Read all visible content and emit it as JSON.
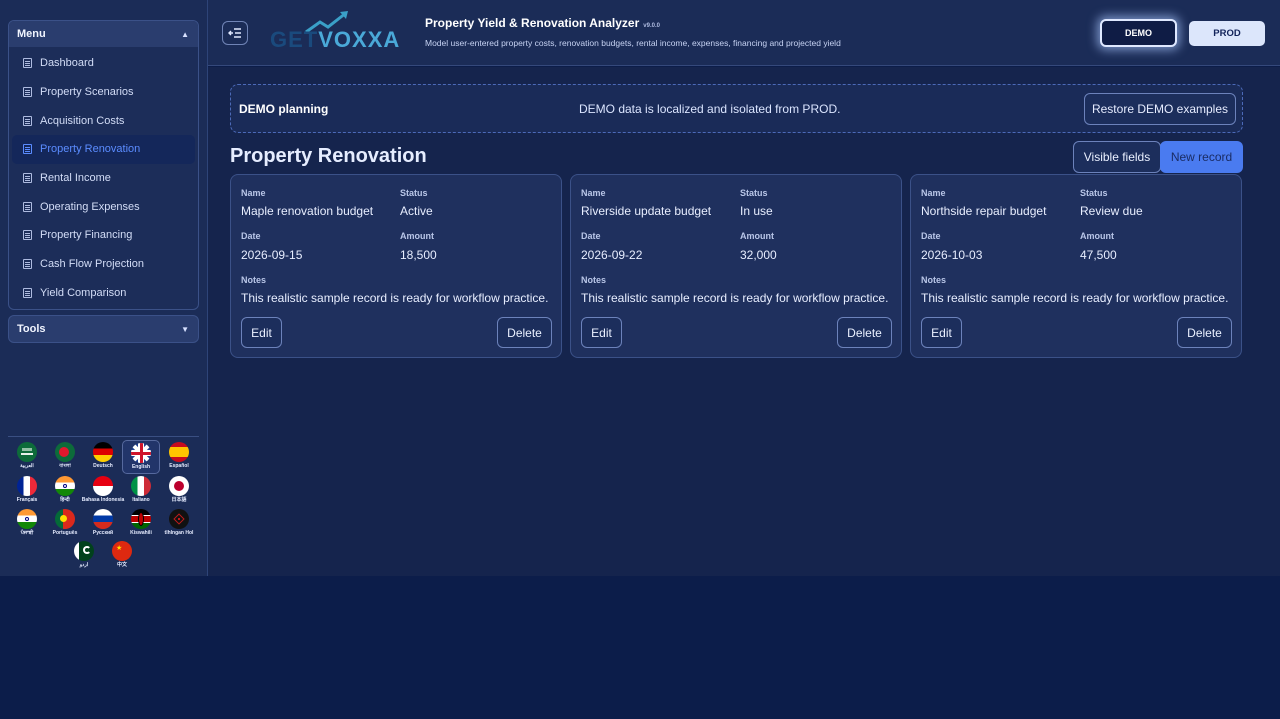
{
  "sidebar": {
    "menu_label": "Menu",
    "tools_label": "Tools",
    "items": [
      {
        "label": "Dashboard"
      },
      {
        "label": "Property Scenarios"
      },
      {
        "label": "Acquisition Costs"
      },
      {
        "label": "Property Renovation"
      },
      {
        "label": "Rental Income"
      },
      {
        "label": "Operating Expenses"
      },
      {
        "label": "Property Financing"
      },
      {
        "label": "Cash Flow Projection"
      },
      {
        "label": "Yield Comparison"
      }
    ],
    "active_item": "Property Renovation",
    "languages": [
      {
        "label": "العربية"
      },
      {
        "label": "বাংলা"
      },
      {
        "label": "Deutsch"
      },
      {
        "label": "English"
      },
      {
        "label": "Español"
      },
      {
        "label": "Français"
      },
      {
        "label": "हिन्दी"
      },
      {
        "label": "Bahasa Indonesia"
      },
      {
        "label": "Italiano"
      },
      {
        "label": "日本語"
      },
      {
        "label": "ਪੰਜਾਬੀ"
      },
      {
        "label": "Português"
      },
      {
        "label": "Русский"
      },
      {
        "label": "Kiswahili"
      },
      {
        "label": "tlhIngan Hol"
      },
      {
        "label": "اردو"
      },
      {
        "label": "中文"
      }
    ],
    "selected_language": "English"
  },
  "header": {
    "logo_text_a": "GET",
    "logo_text_b": "VOXXA",
    "title": "Property Yield & Renovation Analyzer",
    "version": "v9.0.0",
    "subtitle": "Model user-entered property costs, renovation budgets, rental income, expenses, financing and projected yield",
    "demo_label": "DEMO",
    "prod_label": "PROD"
  },
  "banner": {
    "title": "DEMO planning",
    "message": "DEMO data is localized and isolated from PROD.",
    "restore_label": "Restore DEMO examples"
  },
  "main": {
    "page_title": "Property Renovation",
    "visible_fields_label": "Visible fields",
    "new_record_label": "New record"
  },
  "field_labels": {
    "name": "Name",
    "status": "Status",
    "date": "Date",
    "amount": "Amount",
    "notes": "Notes"
  },
  "records": [
    {
      "name": "Maple renovation budget",
      "status": "Active",
      "date": "2026-09-15",
      "amount": "18,500",
      "notes": "This realistic sample record is ready for workflow practice.",
      "edit_label": "Edit",
      "delete_label": "Delete"
    },
    {
      "name": "Riverside update budget",
      "status": "In use",
      "date": "2026-09-22",
      "amount": "32,000",
      "notes": "This realistic sample record is ready for workflow practice.",
      "edit_label": "Edit",
      "delete_label": "Delete"
    },
    {
      "name": "Northside repair budget",
      "status": "Review due",
      "date": "2026-10-03",
      "amount": "47,500",
      "notes": "This realistic sample record is ready for workflow practice.",
      "edit_label": "Edit",
      "delete_label": "Delete"
    }
  ],
  "colors": {
    "accent": "#4a7bf0",
    "active_menu_text": "#5b8cff",
    "page_bg": "#0c1d4a"
  }
}
